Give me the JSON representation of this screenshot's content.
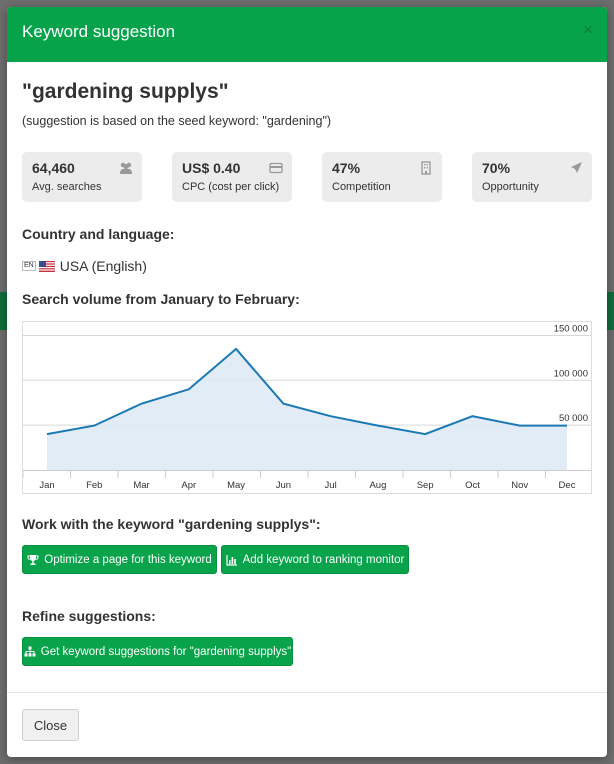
{
  "modal": {
    "title": "Keyword suggestion",
    "close_symbol": "×",
    "keyword_heading": "\"gardening supplys\"",
    "seed_note": "(suggestion is based on the seed keyword: \"gardening\")"
  },
  "stats": [
    {
      "value": "64,460",
      "label": "Avg. searches",
      "icon": "users-icon"
    },
    {
      "value": "US$ 0.40",
      "label": "CPC (cost per click)",
      "icon": "credit-card-icon"
    },
    {
      "value": "47%",
      "label": "Competition",
      "icon": "building-icon"
    },
    {
      "value": "70%",
      "label": "Opportunity",
      "icon": "rocket-icon"
    }
  ],
  "country": {
    "heading": "Country and language:",
    "lang_code": "EN",
    "label": "USA (English)"
  },
  "volume": {
    "heading": "Search volume from January to February:"
  },
  "chart_data": {
    "type": "area",
    "categories": [
      "Jan",
      "Feb",
      "Mar",
      "Apr",
      "May",
      "Jun",
      "Jul",
      "Aug",
      "Sep",
      "Oct",
      "Nov",
      "Dec"
    ],
    "values": [
      40000,
      49500,
      74000,
      90000,
      135000,
      74000,
      60000,
      49500,
      40000,
      60000,
      49500,
      49500
    ],
    "ylim": [
      0,
      165000
    ],
    "yticks": [
      50000,
      100000,
      150000
    ],
    "ytick_labels": [
      "50 000",
      "100 000",
      "150 000"
    ],
    "grid": true,
    "line_color": "#1a78b5",
    "fill_color": "#dce9f4"
  },
  "work": {
    "heading": "Work with the keyword \"gardening supplys\":",
    "optimize_label": "Optimize a page for this keyword",
    "monitor_label": "Add keyword to ranking monitor"
  },
  "refine": {
    "heading": "Refine suggestions:",
    "suggest_label": "Get keyword suggestions for \"gardening supplys\""
  },
  "footer": {
    "close_label": "Close"
  },
  "colors": {
    "header_green": "#06a34a",
    "button_green": "#08a34a"
  }
}
